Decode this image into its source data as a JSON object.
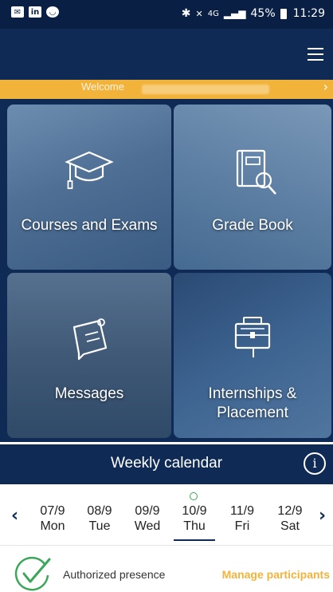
{
  "status_bar": {
    "left_icons": [
      "mail-icon",
      "linkedin-icon",
      "chat-icon"
    ],
    "bluetooth": "✱",
    "mute": "🔇",
    "network": "4G",
    "battery": "45%",
    "time": "11:29"
  },
  "welcome": {
    "label": "Welcome",
    "chevron": "›"
  },
  "tiles": [
    {
      "title": "Courses and Exams",
      "icon": "graduation-cap-icon"
    },
    {
      "title": "Grade Book",
      "icon": "book-search-icon"
    },
    {
      "title": "Messages",
      "icon": "message-note-icon"
    },
    {
      "title_line1": "Internships &",
      "title_line2": "Placement",
      "icon": "briefcase-icon"
    }
  ],
  "weekly": {
    "title": "Weekly calendar",
    "info": "i"
  },
  "days": [
    {
      "date": "07/9",
      "day": "Mon"
    },
    {
      "date": "08/9",
      "day": "Tue"
    },
    {
      "date": "09/9",
      "day": "Wed"
    },
    {
      "date": "10/9",
      "day": "Thu"
    },
    {
      "date": "11/9",
      "day": "Fri"
    },
    {
      "date": "12/9",
      "day": "Sat"
    }
  ],
  "footer": {
    "authorized": "Authorized presence",
    "manage": "Manage participants"
  },
  "colors": {
    "navy": "#0f2b55",
    "accent": "#f2b33b",
    "check": "#3aa657"
  }
}
